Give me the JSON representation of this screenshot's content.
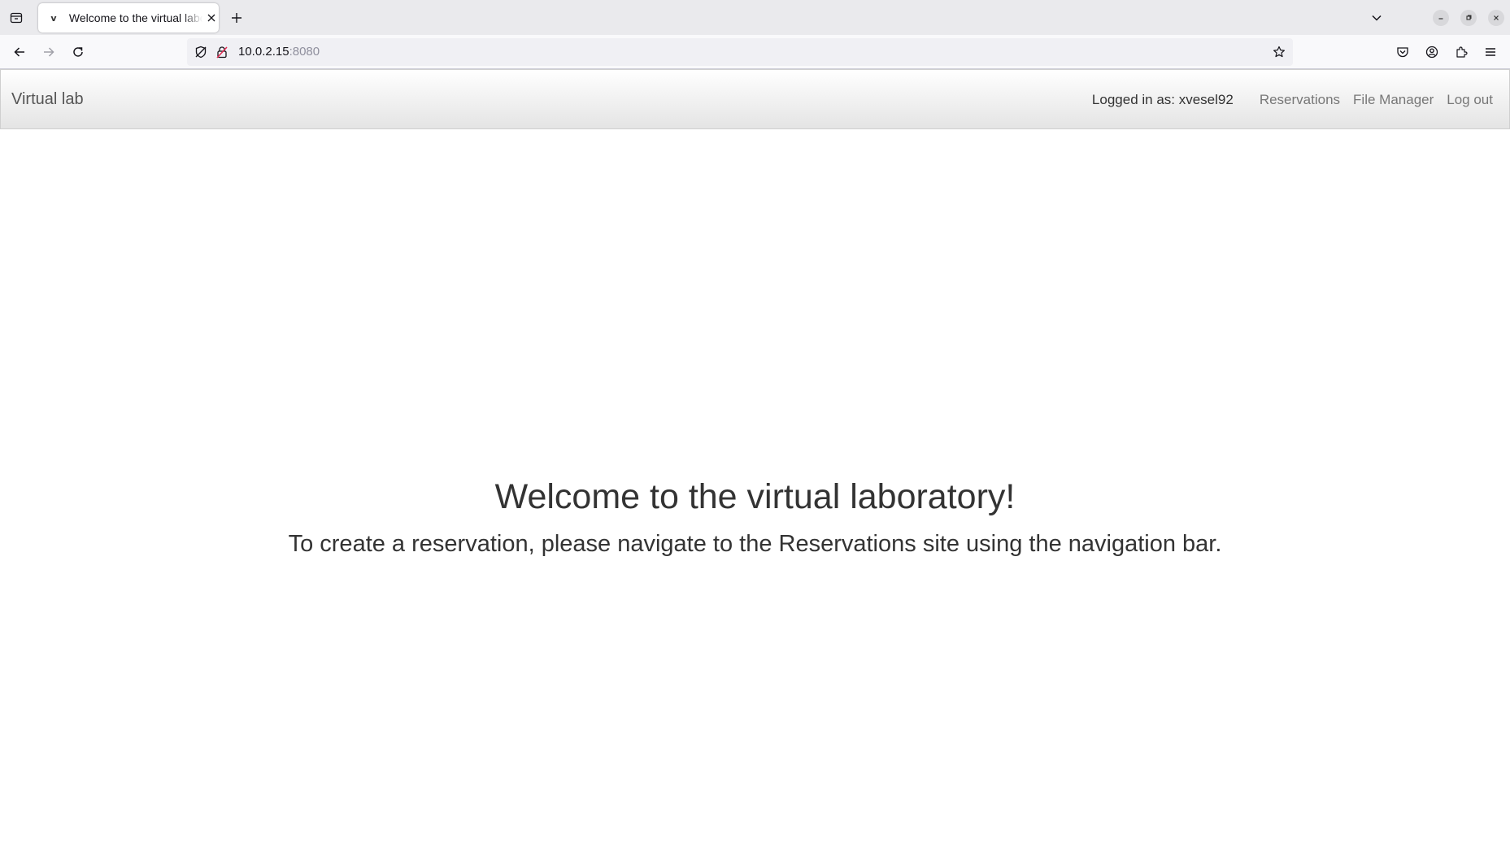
{
  "browser": {
    "tab": {
      "favicon": "v",
      "title": "Welcome to the virtual laboratory!"
    },
    "url": {
      "host": "10.0.2.15",
      "port": ":8080"
    },
    "icons": {
      "tab_list": "tab-list-icon",
      "new_tab": "plus-icon",
      "tabs_overflow": "chevron-down-icon",
      "back": "arrow-left-icon",
      "forward": "arrow-right-icon",
      "reload": "reload-icon",
      "tracking": "shield-icon",
      "insecure": "insecure-lock-icon",
      "bookmark": "star-icon",
      "pocket": "pocket-icon",
      "account": "account-icon",
      "extensions": "puzzle-icon",
      "menu": "hamburger-icon"
    }
  },
  "site_nav": {
    "brand": "Virtual lab",
    "logged_in": "Logged in as: xvesel92",
    "links": [
      "Reservations",
      "File Manager",
      "Log out"
    ]
  },
  "main": {
    "heading": "Welcome to the virtual laboratory!",
    "subheading": "To create a reservation, please navigate to the Reservations site using the navigation bar."
  },
  "colors": {
    "text": "#333333",
    "nav_link": "#777777",
    "brand": "#555555"
  }
}
